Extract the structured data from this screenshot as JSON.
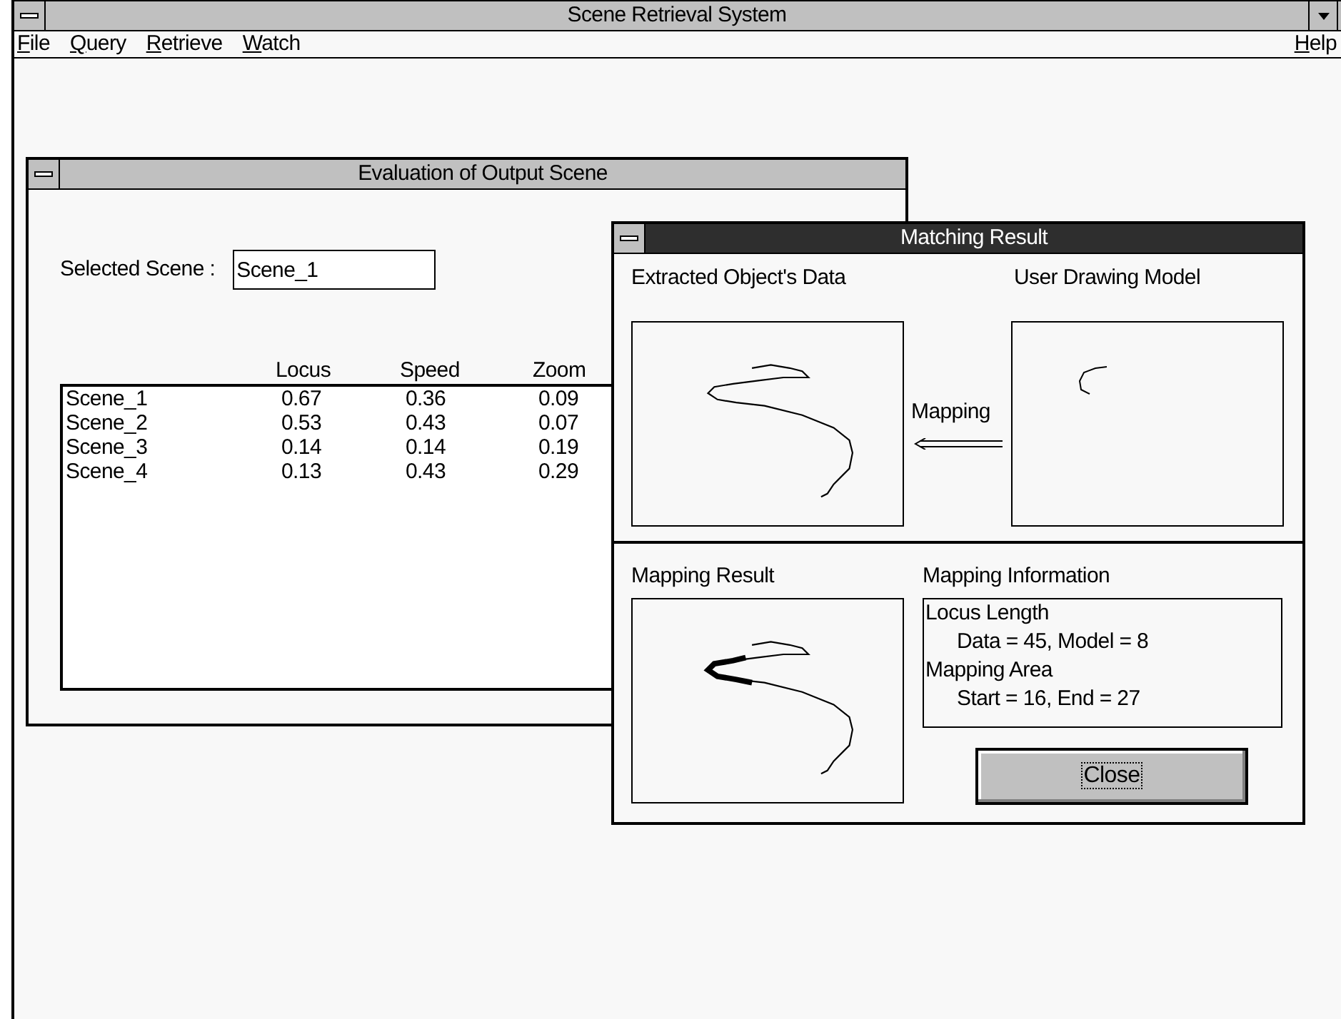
{
  "window": {
    "title": "Scene Retrieval System"
  },
  "menu": [
    {
      "key": "F",
      "rest": "ile"
    },
    {
      "key": "Q",
      "rest": "uery"
    },
    {
      "key": "R",
      "rest": "etrieve"
    },
    {
      "key": "W",
      "rest": "atch"
    }
  ],
  "help_menu": {
    "key": "H",
    "rest": "elp"
  },
  "evaluation_window": {
    "title": "Evaluation of Output Scene",
    "active": false,
    "selected_scene_label": "Selected Scene :",
    "selected_scene": "Scene_1",
    "columns": [
      "Locus",
      "Speed",
      "Zoom"
    ],
    "rows": [
      {
        "name": "Scene_1",
        "values": [
          "0.67",
          "0.36",
          "0.09"
        ]
      },
      {
        "name": "Scene_2",
        "values": [
          "0.53",
          "0.43",
          "0.07"
        ]
      },
      {
        "name": "Scene_3",
        "values": [
          "0.14",
          "0.14",
          "0.19"
        ]
      },
      {
        "name": "Scene_4",
        "values": [
          "0.13",
          "0.43",
          "0.29"
        ]
      }
    ]
  },
  "matching_window": {
    "title": "Matching Result",
    "active": true,
    "extracted_label": "Extracted Object's Data",
    "model_label": "User Drawing Model",
    "mapping_label": "Mapping",
    "result_label": "Mapping Result",
    "info_label": "Mapping Information",
    "info_lines": [
      {
        "kind": "heading",
        "text": "Locus Length"
      },
      {
        "kind": "detail",
        "text": "Data = 45, Model = 8"
      },
      {
        "kind": "heading",
        "text": "Mapping Area"
      },
      {
        "kind": "detail",
        "text": "Start = 16, End = 27"
      }
    ],
    "close_button": "Close"
  }
}
